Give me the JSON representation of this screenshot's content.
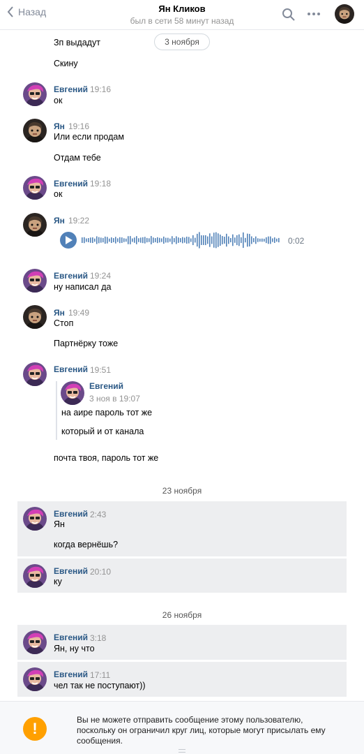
{
  "header": {
    "back_label": "Назад",
    "contact_name": "Ян Кликов",
    "status": "был в сети 58 минут назад"
  },
  "date_pills": {
    "nov3": "3 ноября",
    "nov23": "23 ноября",
    "nov26": "26 ноября"
  },
  "messages": {
    "m1_text1": "Зп выдадут",
    "m1_text2": "Скину",
    "m2": {
      "name": "Евгений",
      "time": "19:16",
      "text": "ок"
    },
    "m3": {
      "name": "Ян",
      "time": "19:16",
      "text1": "Или если продам",
      "text2": "Отдам тебе"
    },
    "m4": {
      "name": "Евгений",
      "time": "19:18",
      "text": "ок"
    },
    "m5": {
      "name": "Ян",
      "time": "19:22",
      "voice_duration": "0:02"
    },
    "m6": {
      "name": "Евгений",
      "time": "19:24",
      "text": "ну написал да"
    },
    "m7": {
      "name": "Ян",
      "time": "19:49",
      "text1": "Стоп",
      "text2": "Партнёрку тоже"
    },
    "m8": {
      "name": "Евгений",
      "time": "19:51",
      "forward": {
        "name": "Евгений",
        "date": "3 ноя в 19:07",
        "text1": "на аире пароль тот же",
        "text2": "который и от канала"
      },
      "text": "почта твоя, пароль тот же"
    },
    "m9": {
      "name": "Евгений",
      "time": "2:43",
      "text1": "Ян",
      "text2": "когда вернёшь?"
    },
    "m10": {
      "name": "Евгений",
      "time": "20:10",
      "text": "ку"
    },
    "m11": {
      "name": "Евгений",
      "time": "3:18",
      "text": "Ян, ну что"
    },
    "m12": {
      "name": "Евгений",
      "time": "17:11",
      "text": "чел так не поступают))"
    }
  },
  "footer": {
    "warning_icon": "!",
    "notice": "Вы не можете отправить сообщение этому пользователю, поскольку он ограничил круг лиц, которые могут присылать ему сообщения."
  },
  "colors": {
    "link_name": "#2a5885",
    "accent_blue": "#5181b8",
    "highlight_bg": "#edeef0",
    "warning": "#ffa000"
  }
}
